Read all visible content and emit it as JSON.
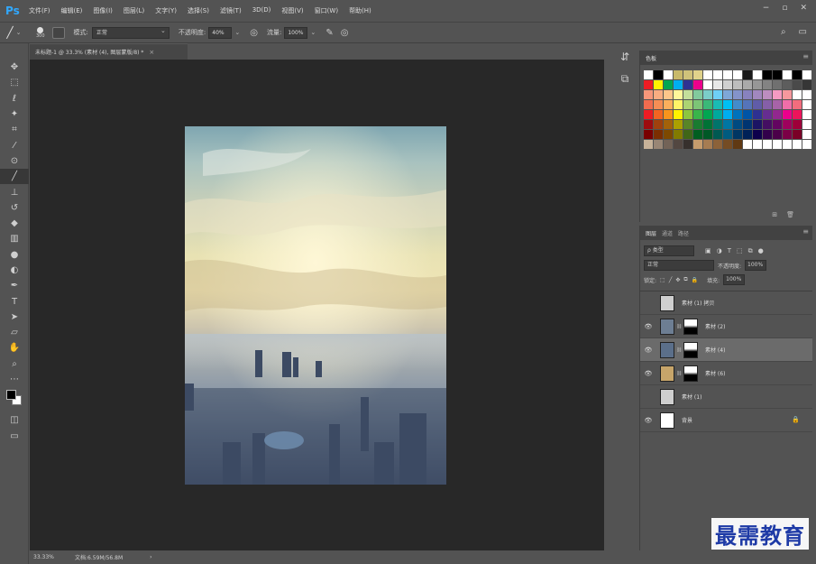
{
  "app": {
    "logo": "Ps"
  },
  "menu": [
    "文件(F)",
    "编辑(E)",
    "图像(I)",
    "图层(L)",
    "文字(Y)",
    "选择(S)",
    "滤镜(T)",
    "3D(D)",
    "视图(V)",
    "窗口(W)",
    "帮助(H)"
  ],
  "window_controls": [
    "−",
    "▫",
    "✕"
  ],
  "options": {
    "brush_size": "300",
    "mode_label": "模式:",
    "mode_value": "正常",
    "opacity_label": "不透明度:",
    "opacity_value": "40%",
    "flow_label": "流量:",
    "flow_value": "100%"
  },
  "document_tab": {
    "title": "未标题-1 @ 33.3% (素材 (4), 图层蒙版/8) *",
    "close": "×"
  },
  "status": {
    "zoom": "33.33%",
    "doc_info": "文档:6.59M/56.8M",
    "arrow": "›"
  },
  "swatches_panel": {
    "tab": "色板",
    "colors": [
      "#ffffff",
      "#000000",
      "#ffffff",
      "#c8b96a",
      "#cfc27a",
      "#e0d28a",
      "#ffffff",
      "#ffffff",
      "#ffffff",
      "#ffffff",
      "#1a1a1a",
      "#ffffff",
      "#000000",
      "#000000",
      "#ffffff",
      "#000000",
      "#ffffff",
      "#ed1c24",
      "#fff200",
      "#00a651",
      "#00aeef",
      "#2e3192",
      "#ec008c",
      "#ffffff",
      "#e8e8e8",
      "#d0d0d0",
      "#bdbdbd",
      "#aaaaaa",
      "#979797",
      "#838383",
      "#707070",
      "#5d5d5d",
      "#4a4a4a",
      "#363636",
      "#f7977a",
      "#f9ad81",
      "#fdc68a",
      "#fff79a",
      "#c4df9b",
      "#82ca9d",
      "#7bcdc8",
      "#6ecff6",
      "#7ea7d8",
      "#8493ca",
      "#8882be",
      "#a187be",
      "#bc8dbf",
      "#f49ac2",
      "#f6989d",
      "#ffffff",
      "#ffffff",
      "#f26c4f",
      "#f68e55",
      "#fbaf5c",
      "#fff467",
      "#acd372",
      "#7cc576",
      "#3bb878",
      "#1abbb4",
      "#00bff3",
      "#438ccb",
      "#5574b9",
      "#605ca8",
      "#855fa8",
      "#a763a8",
      "#f06ea9",
      "#f26d7d",
      "#ffffff",
      "#ed1c24",
      "#f26522",
      "#f7941d",
      "#fff200",
      "#8dc63f",
      "#39b54a",
      "#00a651",
      "#00a99d",
      "#00aeef",
      "#0072bc",
      "#0054a6",
      "#2e3192",
      "#662d91",
      "#92278f",
      "#ec008c",
      "#ed145b",
      "#ffffff",
      "#9e0b0f",
      "#a0410d",
      "#a3620a",
      "#aba000",
      "#598527",
      "#197b30",
      "#007236",
      "#00746b",
      "#0076a3",
      "#004a80",
      "#003471",
      "#1b1464",
      "#440e62",
      "#630460",
      "#9e005d",
      "#9e0039",
      "#ffffff",
      "#790000",
      "#7b2e00",
      "#7d4900",
      "#827b00",
      "#406618",
      "#005e20",
      "#005826",
      "#005952",
      "#005b7f",
      "#003663",
      "#002157",
      "#0d004c",
      "#32004b",
      "#4b0049",
      "#7b0046",
      "#7a0026",
      "#ffffff",
      "#c7b299",
      "#998675",
      "#736357",
      "#534741",
      "#37302d",
      "#c69c6d",
      "#a67c52",
      "#8c6239",
      "#754c24",
      "#603913",
      "#ffffff",
      "#ffffff",
      "#ffffff",
      "#ffffff",
      "#ffffff",
      "#ffffff",
      "#ffffff"
    ]
  },
  "layers_panel": {
    "tabs": [
      "图层",
      "通道",
      "路径"
    ],
    "kind_label": "ρ 类型",
    "blend_mode": "正常",
    "opacity_label": "不透明度:",
    "opacity_value": "100%",
    "lock_label": "锁定:",
    "fill_label": "填充:",
    "fill_value": "100%",
    "layers": [
      {
        "name": "素材 (1) 拷贝",
        "visible": false,
        "selected": false,
        "mask": false,
        "thumb": "#cfcfcf"
      },
      {
        "name": "素材 (2)",
        "visible": true,
        "selected": false,
        "mask": true,
        "thumb": "#6d7e93"
      },
      {
        "name": "素材 (4)",
        "visible": true,
        "selected": true,
        "mask": true,
        "thumb": "#5b6f8a"
      },
      {
        "name": "素材 (6)",
        "visible": true,
        "selected": false,
        "mask": true,
        "thumb": "#c7a56a"
      },
      {
        "name": "素材 (1)",
        "visible": false,
        "selected": false,
        "mask": false,
        "thumb": "#cfcfcf"
      },
      {
        "name": "背景",
        "visible": true,
        "selected": false,
        "mask": false,
        "thumb": "#ffffff",
        "locked": true
      }
    ]
  },
  "watermark": "最需教育"
}
